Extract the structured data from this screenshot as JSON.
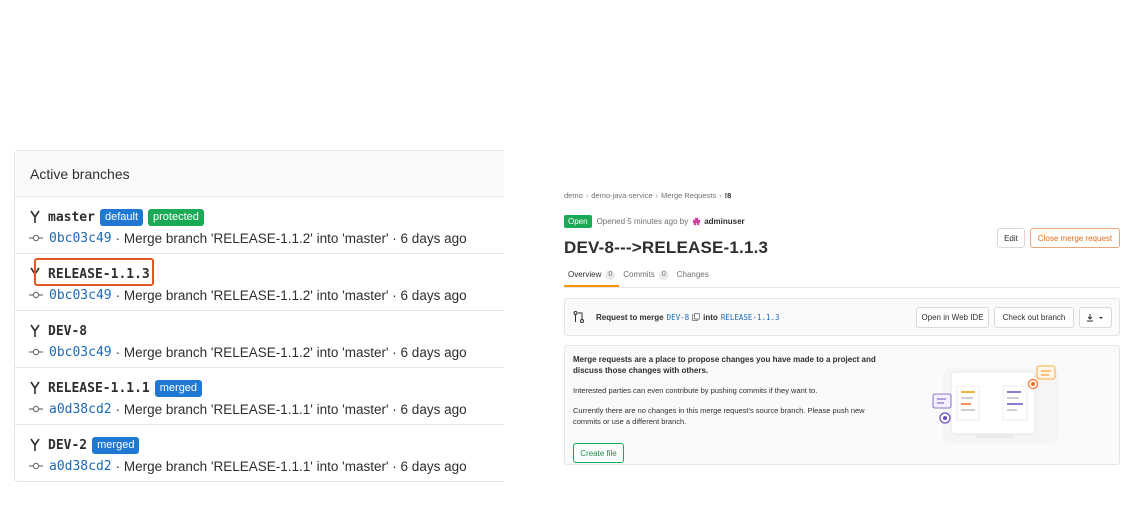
{
  "branches": {
    "header": "Active branches",
    "rows": [
      {
        "name": "master",
        "badges": [
          {
            "label": "default",
            "color": "#1f78d1"
          },
          {
            "label": "protected",
            "color": "#1aaa55"
          }
        ],
        "sha": "0bc03c49",
        "message": "· Merge branch 'RELEASE-1.1.2' into 'master' · 6 days ago"
      },
      {
        "name": "RELEASE-1.1.3",
        "badges": [],
        "sha": "0bc03c49",
        "message": "· Merge branch 'RELEASE-1.1.2' into 'master' · 6 days ago"
      },
      {
        "name": "DEV-8",
        "badges": [],
        "sha": "0bc03c49",
        "message": "· Merge branch 'RELEASE-1.1.2' into 'master' · 6 days ago"
      },
      {
        "name": "RELEASE-1.1.1",
        "badges": [
          {
            "label": "merged",
            "color": "#1f78d1"
          }
        ],
        "sha": "a0d38cd2",
        "message": "· Merge branch 'RELEASE-1.1.1' into 'master' · 6 days ago"
      },
      {
        "name": "DEV-2",
        "badges": [
          {
            "label": "merged",
            "color": "#1f78d1"
          }
        ],
        "sha": "a0d38cd2",
        "message": "· Merge branch 'RELEASE-1.1.1' into 'master' · 6 days ago"
      }
    ]
  },
  "mr": {
    "breadcrumb": [
      "demo",
      "demo-java-service",
      "Merge Requests",
      "!8"
    ],
    "status": "Open",
    "opened_text": "Opened 5 minutes ago by",
    "author": "adminuser",
    "edit_label": "Edit",
    "close_label": "Close merge request",
    "title": "DEV-8--->RELEASE-1.1.3",
    "tabs": [
      {
        "label": "Overview",
        "count": "0"
      },
      {
        "label": "Commits",
        "count": "0"
      },
      {
        "label": "Changes",
        "count": ""
      }
    ],
    "widget": {
      "prefix": "Request to merge",
      "source": "DEV-8",
      "into": "into",
      "target": "RELEASE-1.1.3",
      "web_ide_label": "Open in Web IDE",
      "checkout_label": "Check out branch"
    },
    "empty_state": {
      "lead": "Merge requests are a place to propose changes you have made to a project and discuss those changes with others.",
      "p1": "Interested parties can even contribute by pushing commits if they want to.",
      "p2": "Currently there are no changes in this merge request's source branch. Please push new commits or use a different branch.",
      "create_label": "Create file"
    }
  },
  "colors": {
    "accent_blue": "#1f78d1",
    "success_green": "#1aaa55",
    "warning_orange": "#db6c1c",
    "highlight": "#e25822"
  }
}
